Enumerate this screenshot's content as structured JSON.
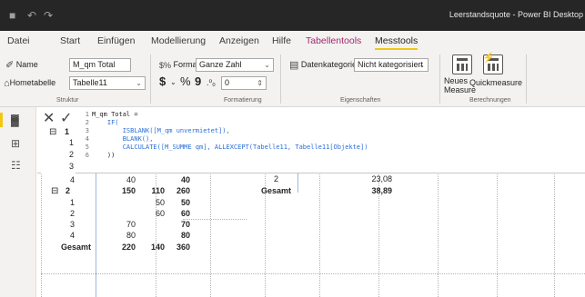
{
  "window": {
    "title": "Leerstandsquote - Power BI Desktop",
    "qa_save": "■",
    "qa_undo": "↶",
    "qa_redo": "↷"
  },
  "menu": {
    "datei": "Datei",
    "start": "Start",
    "einfuegen": "Einfügen",
    "modellierung": "Modellierung",
    "anzeigen": "Anzeigen",
    "hilfe": "Hilfe",
    "tabellentools": "Tabellentools",
    "messtools": "Messtools"
  },
  "ribbon": {
    "name_label": "Name",
    "name_value": "M_qm Total",
    "hometable_label": "Hometabelle",
    "hometable_value": "Tabelle11",
    "format_label": "Format",
    "format_value": "Ganze Zahl",
    "currency_symbol": "$",
    "percent_symbol": "%",
    "comma_symbol": "9",
    "decimals_value": "0",
    "datacat_label": "Datenkategorie",
    "datacat_value": "Nicht kategorisiert",
    "new_measure": "Neues\nMeasure",
    "quick_measure": "Quickmeasure",
    "group_structure": "Struktur",
    "group_formatting": "Formatierung",
    "group_properties": "Eigenschaften",
    "group_calc": "Berechnungen"
  },
  "rail": {
    "report": "report-icon",
    "data": "table-icon",
    "model": "model-icon"
  },
  "editor": {
    "cancel": "✕",
    "commit": "✓",
    "line_numbers": [
      "1",
      "2",
      "3",
      "4",
      "5",
      "6"
    ],
    "lines": [
      "M_qm Total =",
      "    IF(",
      "        ISBLANK([M_qm unvermietet]),",
      "        BLANK(),",
      "        CALCULATE([M_SUMME qm], ALLEXCEPT(Tabelle11, Tabelle11[Objekte])",
      "    ))"
    ]
  },
  "matrix": {
    "rows_hidden": [
      {
        "label": "1",
        "expand": "⊟",
        "bold": true
      },
      {
        "label": "1"
      },
      {
        "label": "2"
      },
      {
        "label": "3"
      }
    ],
    "rows": [
      {
        "label": "4",
        "c1": "40",
        "c2": "",
        "c3": "40",
        "bold": false,
        "expand": ""
      },
      {
        "label": "2",
        "c1": "150",
        "c2": "110",
        "c3": "260",
        "bold": true,
        "expand": "⊟"
      },
      {
        "label": "1",
        "c1": "",
        "c2": "50",
        "c3": "50",
        "bold": false,
        "expand": ""
      },
      {
        "label": "2",
        "c1": "",
        "c2": "60",
        "c3": "60",
        "bold": false,
        "expand": ""
      },
      {
        "label": "3",
        "c1": "70",
        "c2": "",
        "c3": "70",
        "bold": false,
        "expand": ""
      },
      {
        "label": "4",
        "c1": "80",
        "c2": "",
        "c3": "80",
        "bold": false,
        "expand": ""
      },
      {
        "label": "Gesamt",
        "c1": "220",
        "c2": "140",
        "c3": "360",
        "bold": true,
        "expand": ""
      }
    ]
  },
  "side_table": {
    "row1_label": "2",
    "row1_value": "23,08",
    "total_label": "Gesamt",
    "total_value": "38,89"
  }
}
